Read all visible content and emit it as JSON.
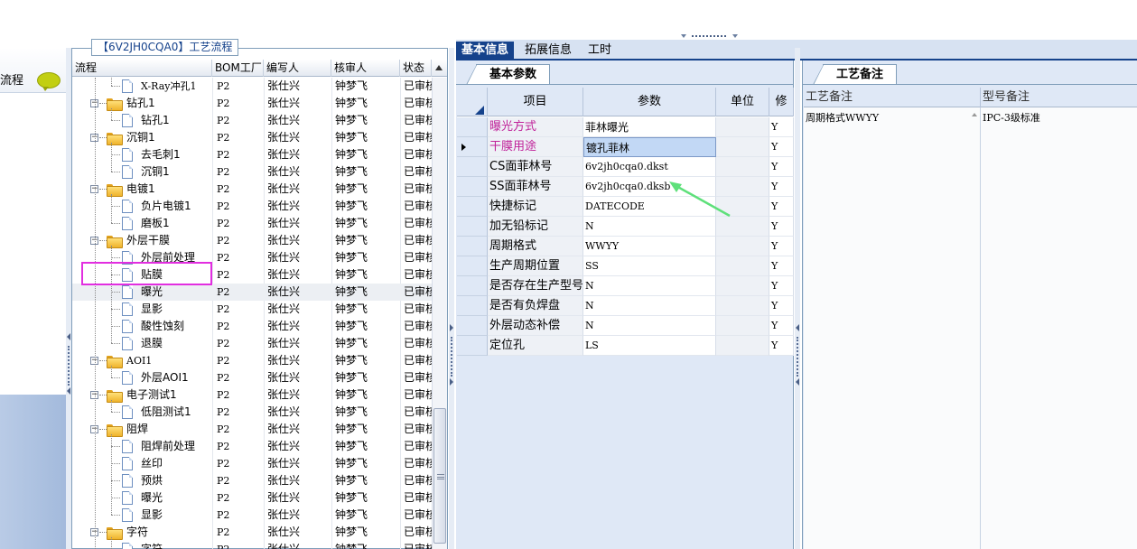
{
  "left_panel": {
    "title": "流程"
  },
  "tree": {
    "caption": "【6V2JH0CQA0】工艺流程",
    "columns": [
      "流程",
      "BOM工厂",
      "编写人",
      "核审人",
      "状态"
    ],
    "rows": [
      {
        "label": "X-Ray冲孔1",
        "depth": 2,
        "type": "doc",
        "plant": "P2",
        "writer": "张仕兴",
        "reviewer": "钟梦飞",
        "status": "已审核"
      },
      {
        "label": "钻孔1",
        "depth": 1,
        "type": "folder",
        "plant": "P2",
        "writer": "张仕兴",
        "reviewer": "钟梦飞",
        "status": "已审核"
      },
      {
        "label": "钻孔1",
        "depth": 2,
        "type": "doc",
        "plant": "P2",
        "writer": "张仕兴",
        "reviewer": "钟梦飞",
        "status": "已审核"
      },
      {
        "label": "沉铜1",
        "depth": 1,
        "type": "folder",
        "plant": "P2",
        "writer": "张仕兴",
        "reviewer": "钟梦飞",
        "status": "已审核"
      },
      {
        "label": "去毛刺1",
        "depth": 2,
        "type": "doc",
        "plant": "P2",
        "writer": "张仕兴",
        "reviewer": "钟梦飞",
        "status": "已审核"
      },
      {
        "label": "沉铜1",
        "depth": 2,
        "type": "doc",
        "plant": "P2",
        "writer": "张仕兴",
        "reviewer": "钟梦飞",
        "status": "已审核"
      },
      {
        "label": "电镀1",
        "depth": 1,
        "type": "folder",
        "plant": "P2",
        "writer": "张仕兴",
        "reviewer": "钟梦飞",
        "status": "已审核"
      },
      {
        "label": "负片电镀1",
        "depth": 2,
        "type": "doc",
        "plant": "P2",
        "writer": "张仕兴",
        "reviewer": "钟梦飞",
        "status": "已审核"
      },
      {
        "label": "磨板1",
        "depth": 2,
        "type": "doc",
        "plant": "P2",
        "writer": "张仕兴",
        "reviewer": "钟梦飞",
        "status": "已审核"
      },
      {
        "label": "外层干膜",
        "depth": 1,
        "type": "folder",
        "plant": "P2",
        "writer": "张仕兴",
        "reviewer": "钟梦飞",
        "status": "已审核"
      },
      {
        "label": "外层前处理",
        "depth": 2,
        "type": "doc",
        "plant": "P2",
        "writer": "张仕兴",
        "reviewer": "钟梦飞",
        "status": "已审核"
      },
      {
        "label": "贴膜",
        "depth": 2,
        "type": "doc",
        "plant": "P2",
        "writer": "张仕兴",
        "reviewer": "钟梦飞",
        "status": "已审核"
      },
      {
        "label": "曝光",
        "depth": 2,
        "type": "doc",
        "plant": "P2",
        "writer": "张仕兴",
        "reviewer": "钟梦飞",
        "status": "已审核",
        "selected": true
      },
      {
        "label": "显影",
        "depth": 2,
        "type": "doc",
        "plant": "P2",
        "writer": "张仕兴",
        "reviewer": "钟梦飞",
        "status": "已审核"
      },
      {
        "label": "酸性蚀刻",
        "depth": 2,
        "type": "doc",
        "plant": "P2",
        "writer": "张仕兴",
        "reviewer": "钟梦飞",
        "status": "已审核"
      },
      {
        "label": "退膜",
        "depth": 2,
        "type": "doc",
        "plant": "P2",
        "writer": "张仕兴",
        "reviewer": "钟梦飞",
        "status": "已审核"
      },
      {
        "label": "AOI1",
        "depth": 1,
        "type": "folder",
        "plant": "P2",
        "writer": "张仕兴",
        "reviewer": "钟梦飞",
        "status": "已审核"
      },
      {
        "label": "外层AOI1",
        "depth": 2,
        "type": "doc",
        "plant": "P2",
        "writer": "张仕兴",
        "reviewer": "钟梦飞",
        "status": "已审核"
      },
      {
        "label": "电子测试1",
        "depth": 1,
        "type": "folder",
        "plant": "P2",
        "writer": "张仕兴",
        "reviewer": "钟梦飞",
        "status": "已审核"
      },
      {
        "label": "低阻测试1",
        "depth": 2,
        "type": "doc",
        "plant": "P2",
        "writer": "张仕兴",
        "reviewer": "钟梦飞",
        "status": "已审核"
      },
      {
        "label": "阻焊",
        "depth": 1,
        "type": "folder",
        "plant": "P2",
        "writer": "张仕兴",
        "reviewer": "钟梦飞",
        "status": "已审核"
      },
      {
        "label": "阻焊前处理",
        "depth": 2,
        "type": "doc",
        "plant": "P2",
        "writer": "张仕兴",
        "reviewer": "钟梦飞",
        "status": "已审核"
      },
      {
        "label": "丝印",
        "depth": 2,
        "type": "doc",
        "plant": "P2",
        "writer": "张仕兴",
        "reviewer": "钟梦飞",
        "status": "已审核"
      },
      {
        "label": "预烘",
        "depth": 2,
        "type": "doc",
        "plant": "P2",
        "writer": "张仕兴",
        "reviewer": "钟梦飞",
        "status": "已审核"
      },
      {
        "label": "曝光",
        "depth": 2,
        "type": "doc",
        "plant": "P2",
        "writer": "张仕兴",
        "reviewer": "钟梦飞",
        "status": "已审核"
      },
      {
        "label": "显影",
        "depth": 2,
        "type": "doc",
        "plant": "P2",
        "writer": "张仕兴",
        "reviewer": "钟梦飞",
        "status": "已审核"
      },
      {
        "label": "字符",
        "depth": 1,
        "type": "folder",
        "plant": "P2",
        "writer": "张仕兴",
        "reviewer": "钟梦飞",
        "status": "已审核"
      },
      {
        "label": "字符",
        "depth": 2,
        "type": "doc",
        "plant": "P2",
        "writer": "张仕兴",
        "reviewer": "钟梦飞",
        "status": "已审核"
      }
    ]
  },
  "tabs": [
    {
      "label": "基本信息",
      "active": true
    },
    {
      "label": "拓展信息",
      "active": false
    },
    {
      "label": "工时",
      "active": false
    }
  ],
  "params": {
    "subtab": "基本参数",
    "columns": [
      "项目",
      "参数",
      "单位",
      "修"
    ],
    "rows": [
      {
        "item": "曝光方式",
        "value": "菲林曝光",
        "unit": "",
        "flag": "Y",
        "pink": true
      },
      {
        "item": "干膜用途",
        "value": "镀孔菲林",
        "unit": "",
        "flag": "Y",
        "pink": true,
        "current": true
      },
      {
        "item": "CS面菲林号",
        "value": "6v2jh0cqa0.dkst",
        "unit": "",
        "flag": "Y"
      },
      {
        "item": "SS面菲林号",
        "value": "6v2jh0cqa0.dksb",
        "unit": "",
        "flag": "Y"
      },
      {
        "item": "快捷标记",
        "value": "DATECODE",
        "unit": "",
        "flag": "Y"
      },
      {
        "item": "加无铅标记",
        "value": "N",
        "unit": "",
        "flag": "Y"
      },
      {
        "item": "周期格式",
        "value": "WWYY",
        "unit": "",
        "flag": "Y"
      },
      {
        "item": "生产周期位置",
        "value": "SS",
        "unit": "",
        "flag": "Y"
      },
      {
        "item": "是否存在生产型号",
        "value": "N",
        "unit": "",
        "flag": "Y"
      },
      {
        "item": "是否有负焊盘",
        "value": "N",
        "unit": "",
        "flag": "Y"
      },
      {
        "item": "外层动态补偿",
        "value": "N",
        "unit": "",
        "flag": "Y"
      },
      {
        "item": "定位孔",
        "value": "LS",
        "unit": "",
        "flag": "Y"
      }
    ]
  },
  "remarks": {
    "subtab": "工艺备注",
    "col1": "工艺备注",
    "col2": "型号备注",
    "process_note": "周期格式WWYY",
    "model_note": "IPC-3级标准"
  },
  "colors": {
    "accent": "#15428b",
    "highlight_box": "#e22ee0",
    "arrow": "#5ee07a",
    "pink_label": "#c0239a"
  }
}
